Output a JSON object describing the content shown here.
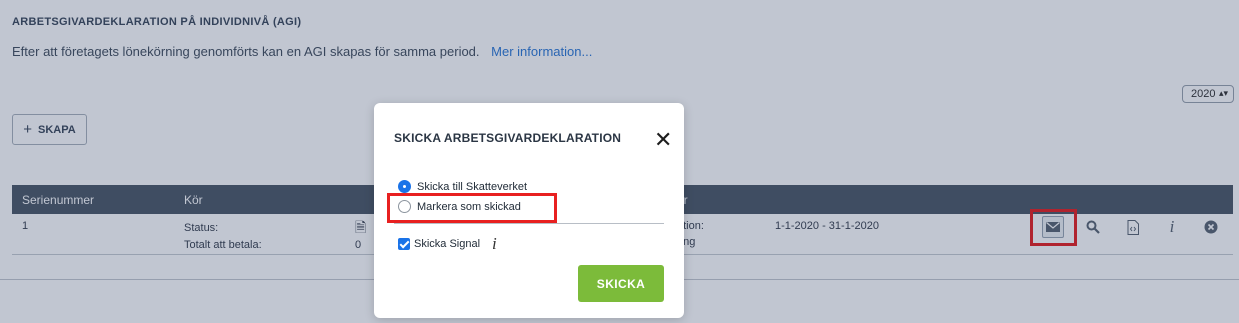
{
  "section": {
    "title": "ARBETSGIVARDEKLARATION PÅ INDIVIDNIVÅ (AGI)",
    "intro": "Efter att företagets lönekörning genomförts kan en AGI skapas för samma period.",
    "more_link": "Mer information..."
  },
  "year_select": {
    "value": "2020"
  },
  "create_button": {
    "label": "SKAPA"
  },
  "table": {
    "headers": {
      "serial": "Serienummer",
      "run": "Kör",
      "period": "er"
    },
    "row": {
      "serial": "1",
      "status_label": "Status:",
      "total_label": "Totalt att betala:",
      "total_value": "0",
      "period_label_1": "ation:",
      "period_label_2": "ring",
      "period_value": "1-1-2020 - 31-1-2020"
    },
    "icons": [
      "envelope-icon",
      "search-icon",
      "code-file-icon",
      "info-icon",
      "close-circle-icon"
    ]
  },
  "modal": {
    "title": "SKICKA ARBETSGIVARDEKLARATION",
    "options": [
      {
        "label": "Skicka till Skatteverket",
        "selected": true
      },
      {
        "label": "Markera som skickad",
        "selected": false
      }
    ],
    "signal_label": "Skicka Signal",
    "signal_checked": true,
    "send_label": "SKICKA"
  },
  "colors": {
    "accent": "#1a73e8",
    "send_button": "#7cbb3a",
    "highlight": "#e82020",
    "table_header": "#4e5a68",
    "link": "#2f7ad6"
  }
}
